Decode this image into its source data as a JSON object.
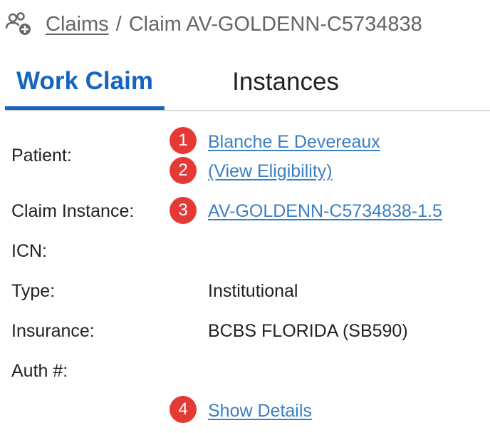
{
  "breadcrumb": {
    "icon": "user-group-add-icon",
    "parent_link": "Claims",
    "separator": "/",
    "current": "Claim AV-GOLDENN-C5734838"
  },
  "tabs": [
    {
      "label": "Work Claim",
      "active": true
    },
    {
      "label": "Instances",
      "active": false
    }
  ],
  "fields": {
    "patient_label": "Patient:",
    "patient_name": "Blanche E Devereaux",
    "view_eligibility": "(View Eligibility)",
    "claim_instance_label": "Claim Instance:",
    "claim_instance_value": "AV-GOLDENN-C5734838-1.5",
    "icn_label": "ICN:",
    "type_label": "Type:",
    "type_value": "Institutional",
    "insurance_label": "Insurance:",
    "insurance_value": "BCBS FLORIDA (SB590)",
    "auth_label": "Auth #:",
    "show_details": "Show Details"
  },
  "badges": [
    "1",
    "2",
    "3",
    "4"
  ],
  "colors": {
    "accent": "#1565c0",
    "link": "#3b7fc4",
    "badge": "#e53935"
  }
}
